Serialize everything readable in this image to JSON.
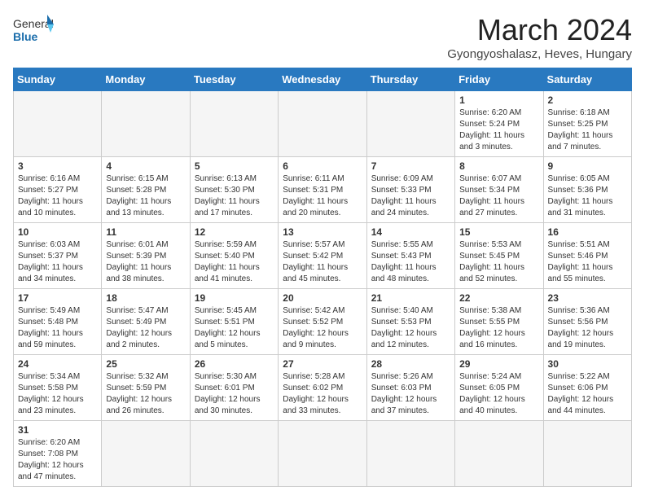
{
  "header": {
    "logo_general": "General",
    "logo_blue": "Blue",
    "month_title": "March 2024",
    "subtitle": "Gyongyoshalasz, Heves, Hungary"
  },
  "days_of_week": [
    "Sunday",
    "Monday",
    "Tuesday",
    "Wednesday",
    "Thursday",
    "Friday",
    "Saturday"
  ],
  "weeks": [
    [
      {
        "day": "",
        "info": ""
      },
      {
        "day": "",
        "info": ""
      },
      {
        "day": "",
        "info": ""
      },
      {
        "day": "",
        "info": ""
      },
      {
        "day": "",
        "info": ""
      },
      {
        "day": "1",
        "info": "Sunrise: 6:20 AM\nSunset: 5:24 PM\nDaylight: 11 hours\nand 3 minutes."
      },
      {
        "day": "2",
        "info": "Sunrise: 6:18 AM\nSunset: 5:25 PM\nDaylight: 11 hours\nand 7 minutes."
      }
    ],
    [
      {
        "day": "3",
        "info": "Sunrise: 6:16 AM\nSunset: 5:27 PM\nDaylight: 11 hours\nand 10 minutes."
      },
      {
        "day": "4",
        "info": "Sunrise: 6:15 AM\nSunset: 5:28 PM\nDaylight: 11 hours\nand 13 minutes."
      },
      {
        "day": "5",
        "info": "Sunrise: 6:13 AM\nSunset: 5:30 PM\nDaylight: 11 hours\nand 17 minutes."
      },
      {
        "day": "6",
        "info": "Sunrise: 6:11 AM\nSunset: 5:31 PM\nDaylight: 11 hours\nand 20 minutes."
      },
      {
        "day": "7",
        "info": "Sunrise: 6:09 AM\nSunset: 5:33 PM\nDaylight: 11 hours\nand 24 minutes."
      },
      {
        "day": "8",
        "info": "Sunrise: 6:07 AM\nSunset: 5:34 PM\nDaylight: 11 hours\nand 27 minutes."
      },
      {
        "day": "9",
        "info": "Sunrise: 6:05 AM\nSunset: 5:36 PM\nDaylight: 11 hours\nand 31 minutes."
      }
    ],
    [
      {
        "day": "10",
        "info": "Sunrise: 6:03 AM\nSunset: 5:37 PM\nDaylight: 11 hours\nand 34 minutes."
      },
      {
        "day": "11",
        "info": "Sunrise: 6:01 AM\nSunset: 5:39 PM\nDaylight: 11 hours\nand 38 minutes."
      },
      {
        "day": "12",
        "info": "Sunrise: 5:59 AM\nSunset: 5:40 PM\nDaylight: 11 hours\nand 41 minutes."
      },
      {
        "day": "13",
        "info": "Sunrise: 5:57 AM\nSunset: 5:42 PM\nDaylight: 11 hours\nand 45 minutes."
      },
      {
        "day": "14",
        "info": "Sunrise: 5:55 AM\nSunset: 5:43 PM\nDaylight: 11 hours\nand 48 minutes."
      },
      {
        "day": "15",
        "info": "Sunrise: 5:53 AM\nSunset: 5:45 PM\nDaylight: 11 hours\nand 52 minutes."
      },
      {
        "day": "16",
        "info": "Sunrise: 5:51 AM\nSunset: 5:46 PM\nDaylight: 11 hours\nand 55 minutes."
      }
    ],
    [
      {
        "day": "17",
        "info": "Sunrise: 5:49 AM\nSunset: 5:48 PM\nDaylight: 11 hours\nand 59 minutes."
      },
      {
        "day": "18",
        "info": "Sunrise: 5:47 AM\nSunset: 5:49 PM\nDaylight: 12 hours\nand 2 minutes."
      },
      {
        "day": "19",
        "info": "Sunrise: 5:45 AM\nSunset: 5:51 PM\nDaylight: 12 hours\nand 5 minutes."
      },
      {
        "day": "20",
        "info": "Sunrise: 5:42 AM\nSunset: 5:52 PM\nDaylight: 12 hours\nand 9 minutes."
      },
      {
        "day": "21",
        "info": "Sunrise: 5:40 AM\nSunset: 5:53 PM\nDaylight: 12 hours\nand 12 minutes."
      },
      {
        "day": "22",
        "info": "Sunrise: 5:38 AM\nSunset: 5:55 PM\nDaylight: 12 hours\nand 16 minutes."
      },
      {
        "day": "23",
        "info": "Sunrise: 5:36 AM\nSunset: 5:56 PM\nDaylight: 12 hours\nand 19 minutes."
      }
    ],
    [
      {
        "day": "24",
        "info": "Sunrise: 5:34 AM\nSunset: 5:58 PM\nDaylight: 12 hours\nand 23 minutes."
      },
      {
        "day": "25",
        "info": "Sunrise: 5:32 AM\nSunset: 5:59 PM\nDaylight: 12 hours\nand 26 minutes."
      },
      {
        "day": "26",
        "info": "Sunrise: 5:30 AM\nSunset: 6:01 PM\nDaylight: 12 hours\nand 30 minutes."
      },
      {
        "day": "27",
        "info": "Sunrise: 5:28 AM\nSunset: 6:02 PM\nDaylight: 12 hours\nand 33 minutes."
      },
      {
        "day": "28",
        "info": "Sunrise: 5:26 AM\nSunset: 6:03 PM\nDaylight: 12 hours\nand 37 minutes."
      },
      {
        "day": "29",
        "info": "Sunrise: 5:24 AM\nSunset: 6:05 PM\nDaylight: 12 hours\nand 40 minutes."
      },
      {
        "day": "30",
        "info": "Sunrise: 5:22 AM\nSunset: 6:06 PM\nDaylight: 12 hours\nand 44 minutes."
      }
    ],
    [
      {
        "day": "31",
        "info": "Sunrise: 6:20 AM\nSunset: 7:08 PM\nDaylight: 12 hours\nand 47 minutes."
      },
      {
        "day": "",
        "info": ""
      },
      {
        "day": "",
        "info": ""
      },
      {
        "day": "",
        "info": ""
      },
      {
        "day": "",
        "info": ""
      },
      {
        "day": "",
        "info": ""
      },
      {
        "day": "",
        "info": ""
      }
    ]
  ]
}
